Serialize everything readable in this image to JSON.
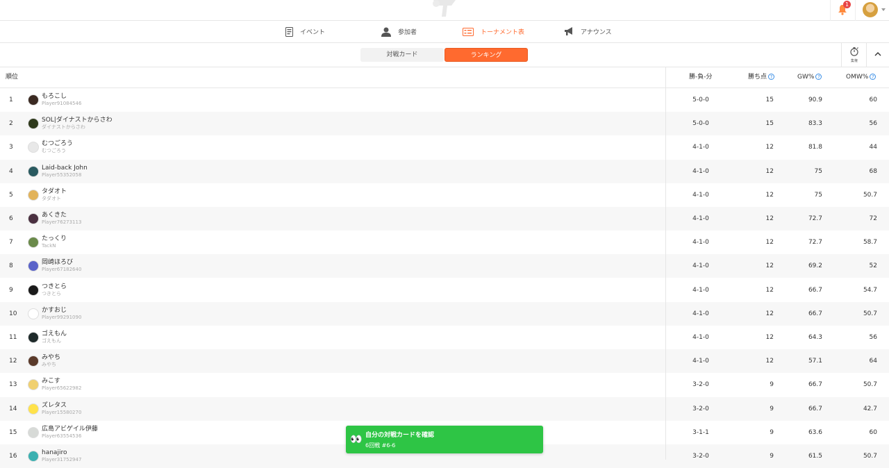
{
  "header": {
    "notification_count": "1"
  },
  "nav": {
    "items": [
      {
        "label": "イベント",
        "icon": "document-icon"
      },
      {
        "label": "参加者",
        "icon": "person-icon"
      },
      {
        "label": "トーナメント表",
        "icon": "bracket-icon",
        "active": true
      },
      {
        "label": "アナウンス",
        "icon": "megaphone-icon"
      }
    ]
  },
  "tabs": {
    "pairing_label": "対戦カード",
    "ranking_label": "ランキング"
  },
  "tools": {
    "timer_label": "集権"
  },
  "table": {
    "headers": {
      "rank": "順位",
      "wld": "勝-負-分",
      "points": "勝ち点",
      "gw": "GW%",
      "omw": "OMW%"
    },
    "rows": [
      {
        "rank": "1",
        "name": "もろこし",
        "sub": "Player91084546",
        "wld": "5-0-0",
        "points": "15",
        "gw": "90.9",
        "omw": "60"
      },
      {
        "rank": "2",
        "name": "SOL|ダイナストからさわ",
        "sub": "ダイナストからさわ",
        "wld": "5-0-0",
        "points": "15",
        "gw": "83.3",
        "omw": "56"
      },
      {
        "rank": "3",
        "name": "むつごろう",
        "sub": "むつごろう",
        "wld": "4-1-0",
        "points": "12",
        "gw": "81.8",
        "omw": "44"
      },
      {
        "rank": "4",
        "name": "Laid-back John",
        "sub": "Player55352058",
        "wld": "4-1-0",
        "points": "12",
        "gw": "75",
        "omw": "68"
      },
      {
        "rank": "5",
        "name": "タダオト",
        "sub": "タダオト",
        "wld": "4-1-0",
        "points": "12",
        "gw": "75",
        "omw": "50.7"
      },
      {
        "rank": "6",
        "name": "あくきた",
        "sub": "Player76273113",
        "wld": "4-1-0",
        "points": "12",
        "gw": "72.7",
        "omw": "72"
      },
      {
        "rank": "7",
        "name": "たっくり",
        "sub": "TackN",
        "wld": "4-1-0",
        "points": "12",
        "gw": "72.7",
        "omw": "58.7"
      },
      {
        "rank": "8",
        "name": "岡崎ほろび",
        "sub": "Player67182640",
        "wld": "4-1-0",
        "points": "12",
        "gw": "69.2",
        "omw": "52"
      },
      {
        "rank": "9",
        "name": "つきとら",
        "sub": "つきとら",
        "wld": "4-1-0",
        "points": "12",
        "gw": "66.7",
        "omw": "54.7"
      },
      {
        "rank": "10",
        "name": "かすおじ",
        "sub": "Player99291090",
        "wld": "4-1-0",
        "points": "12",
        "gw": "66.7",
        "omw": "50.7"
      },
      {
        "rank": "11",
        "name": "ゴえもん",
        "sub": "ゴえもん",
        "wld": "4-1-0",
        "points": "12",
        "gw": "64.3",
        "omw": "56"
      },
      {
        "rank": "12",
        "name": "みやち",
        "sub": "みやち",
        "wld": "4-1-0",
        "points": "12",
        "gw": "57.1",
        "omw": "64"
      },
      {
        "rank": "13",
        "name": "みこす",
        "sub": "Player65622982",
        "wld": "3-2-0",
        "points": "9",
        "gw": "66.7",
        "omw": "50.7"
      },
      {
        "rank": "14",
        "name": "ズレタス",
        "sub": "Player15580270",
        "wld": "3-2-0",
        "points": "9",
        "gw": "66.7",
        "omw": "42.7"
      },
      {
        "rank": "15",
        "name": "広島アビゲイル伊藤",
        "sub": "Player63554536",
        "wld": "3-1-1",
        "points": "9",
        "gw": "63.6",
        "omw": "60"
      },
      {
        "rank": "16",
        "name": "hanajiro",
        "sub": "Player31752947",
        "wld": "3-2-0",
        "points": "9",
        "gw": "61.5",
        "omw": "50.7"
      }
    ],
    "avatar_colors": [
      "#3b2a22",
      "#2f3a1c",
      "#e8e8e8",
      "#2a5a60",
      "#e2b35a",
      "#4a3040",
      "#6a8a4a",
      "#5a63c9",
      "#1a1a1a",
      "#ffffff",
      "#1e2a2a",
      "#5a3a2a",
      "#f0d070",
      "#ffe24a",
      "#d7dad7",
      "#3bb0b0"
    ]
  },
  "toast": {
    "title": "自分の対戦カードを確認",
    "subtitle": "6回戦 #6-6",
    "icon": "eyes-icon"
  },
  "colors": {
    "accent": "#ff6a2f",
    "toast": "#2ec545",
    "help": "#3a8ee6",
    "badge": "#e84545"
  }
}
